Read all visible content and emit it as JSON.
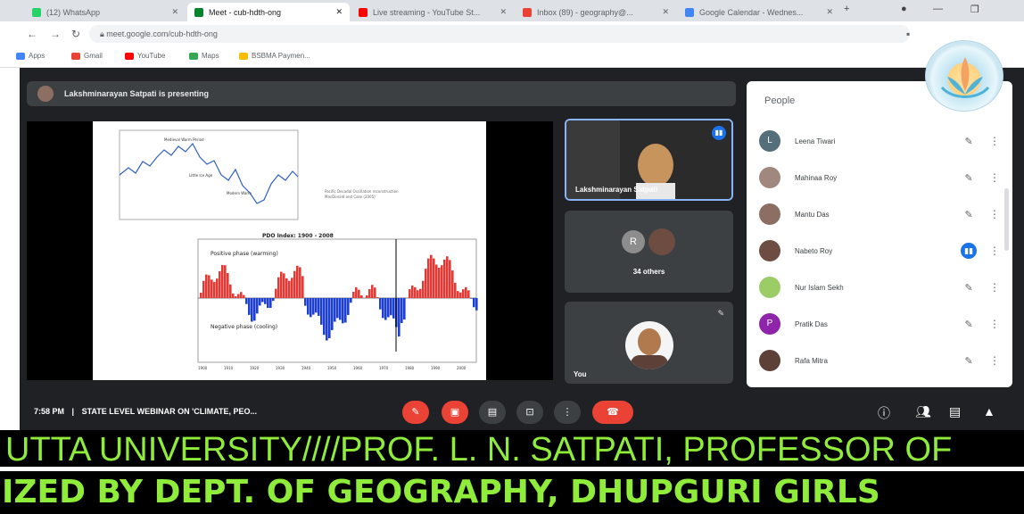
{
  "browser": {
    "tabs": [
      {
        "label": "(12) WhatsApp",
        "color": "#25d366"
      },
      {
        "label": "Meet - cub-hdth-ong",
        "color": "#00832d"
      },
      {
        "label": "Live streaming - YouTube St...",
        "color": "#ff0000"
      },
      {
        "label": "Inbox (89) - geography@...",
        "color": "#ea4335"
      },
      {
        "label": "Google Calendar - Wednes...",
        "color": "#4285f4"
      }
    ],
    "url": "meet.google.com/cub-hdth-ong",
    "bookmarks": [
      {
        "label": "Apps",
        "color": "#4285f4"
      },
      {
        "label": "Gmail",
        "color": "#ea4335"
      },
      {
        "label": "YouTube",
        "color": "#ff0000"
      },
      {
        "label": "Maps",
        "color": "#34a853"
      },
      {
        "label": "BSBMA Paymen...",
        "color": "#fbbc04"
      }
    ]
  },
  "meet": {
    "presenting_banner": "Lakshminarayan Satpati is presenting",
    "tiles": {
      "main_name": "Lakshminarayan Satpati",
      "others_label": "34 others",
      "others_initial": "R",
      "self_label": "You"
    },
    "people": {
      "title": "People",
      "participants": [
        {
          "name": "Leena Tiwari",
          "initial": "L",
          "color": "#546e7a",
          "mic": "muted"
        },
        {
          "name": "Mahinaa Roy",
          "initial": "",
          "color": "#a1887f",
          "mic": "muted"
        },
        {
          "name": "Mantu Das",
          "initial": "",
          "color": "#8d6e63",
          "mic": "muted"
        },
        {
          "name": "Nabeto Roy",
          "initial": "",
          "color": "#6d4c41",
          "mic": "active"
        },
        {
          "name": "Nur Islam Sekh",
          "initial": "",
          "color": "#9ccc65",
          "mic": "muted"
        },
        {
          "name": "Pratik Das",
          "initial": "P",
          "color": "#8e24aa",
          "mic": "muted"
        },
        {
          "name": "Rafa Mitra",
          "initial": "",
          "color": "#5d4037",
          "mic": "muted"
        }
      ]
    },
    "bottom_bar": {
      "time": "7:58 PM",
      "separator": "|",
      "meeting_title": "STATE LEVEL WEBINAR ON 'CLIMATE, PEO..."
    },
    "slide": {
      "top_title": "PDO Index: 1900 - 2008",
      "pos_label": "Positive phase (warming)",
      "neg_label": "Negative phase (cooling)",
      "x_ticks": [
        "1900",
        "1910",
        "1920",
        "1930",
        "1940",
        "1950",
        "1960",
        "1970",
        "1980",
        "1990",
        "2000"
      ]
    }
  },
  "ticker": {
    "line1": "UTTA UNIVERSITY////PROF. L. N. SATPATI, PROFESSOR OF",
    "line2": "IZED BY DEPT. OF GEOGRAPHY, DHUPGURI GIRLS"
  }
}
